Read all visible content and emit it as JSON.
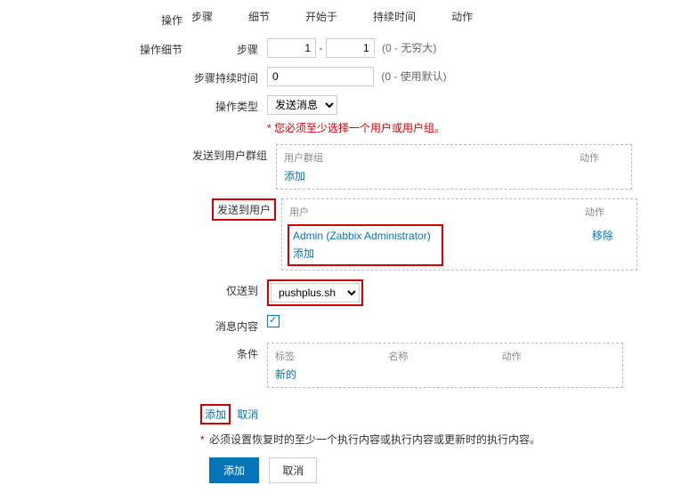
{
  "section_operations_label": "操作",
  "tabs": {
    "steps": "步骤",
    "details": "细节",
    "start_at": "开始于",
    "duration": "持续时间",
    "action": "动作"
  },
  "section_operation_details_label": "操作细节",
  "steps": {
    "label": "步骤",
    "from": "1",
    "dash": "-",
    "to": "1",
    "hint": "(0 - 无穷大)"
  },
  "step_duration": {
    "label": "步骤持续时间",
    "value": "0",
    "hint": "(0 - 使用默认)"
  },
  "operation_type": {
    "label": "操作类型",
    "selected": "发送消息"
  },
  "type_warning": "* 您必须至少选择一个用户或用户组。",
  "send_to_groups": {
    "label": "发送到用户群组",
    "th_group": "用户群组",
    "th_action": "动作",
    "add": "添加"
  },
  "send_to_users": {
    "label": "发送到用户",
    "th_user": "用户",
    "th_action": "动作",
    "rows": [
      {
        "name": "Admin (Zabbix Administrator)",
        "remove": "移除"
      }
    ],
    "add": "添加"
  },
  "only_to": {
    "label": "仅送到",
    "selected": "pushplus.sh"
  },
  "message_content": {
    "label": "消息内容",
    "checked": true
  },
  "conditions": {
    "label": "条件",
    "th_tag": "标签",
    "th_name": "名称",
    "th_action": "动作",
    "new": "新的"
  },
  "footer": {
    "add": "添加",
    "cancel": "取消",
    "warning": "必须设置恢复时的至少一个执行内容或执行内容或更新时的执行内容。",
    "btn_add": "添加",
    "btn_cancel": "取消"
  }
}
